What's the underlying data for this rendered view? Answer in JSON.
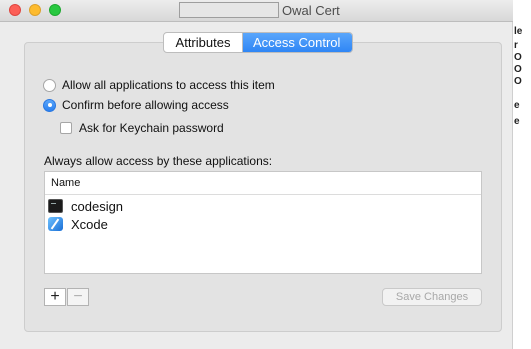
{
  "window": {
    "title": "Owal Cert"
  },
  "tabs": [
    {
      "label": "Attributes",
      "active": false
    },
    {
      "label": "Access Control",
      "active": true
    }
  ],
  "access": {
    "option_allow_all": "Allow all applications to access this item",
    "option_confirm": "Confirm before allowing access",
    "selected_option": "confirm",
    "ask_keychain_password": "Ask for Keychain password",
    "ask_keychain_password_checked": false,
    "always_allow_label": "Always allow access by these applications:"
  },
  "apps_table": {
    "column_header": "Name",
    "rows": [
      {
        "name": "codesign",
        "icon": "terminal-icon"
      },
      {
        "name": "Xcode",
        "icon": "xcode-icon"
      }
    ]
  },
  "buttons": {
    "add": "+",
    "remove": "−",
    "save": "Save Changes"
  },
  "background_window_fragments": [
    "le",
    "r",
    "O",
    "O",
    "O",
    "e",
    "e"
  ],
  "colors": {
    "accent": "#2f86f5",
    "close": "#fc5f57",
    "minimize": "#fdbb2e",
    "maximize": "#28c840"
  }
}
